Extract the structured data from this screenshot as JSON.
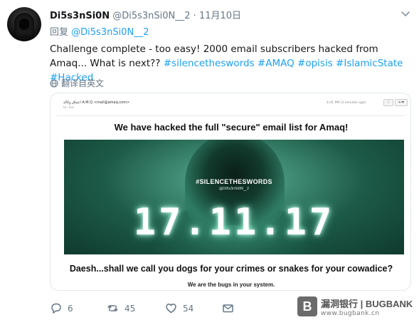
{
  "tweet": {
    "author_name": "Di5s3nSi0N",
    "author_handle": "@Di5s3nSi0N__2",
    "separator": "·",
    "date": "11月10日",
    "reply_prefix": "回复",
    "reply_to": "@Di5s3nSi0N__2",
    "text_main": "Challenge complete - too easy! 2000 email subscribers hacked from Amaq... What is next?? ",
    "hashtags": [
      "#silencetheswords",
      "#AMAQ",
      "#opisis",
      "#IslamicState",
      "#Hacked"
    ],
    "translate_label": "翻译自英文"
  },
  "media": {
    "mail_from": "اعماق وكالة A.M.Q <mail@amaq.com>",
    "mail_to": "to: me",
    "mail_time": "4:41 PM (3 minutes ago)",
    "headline": "We have hacked the full \"secure\" email list for Amaq!",
    "poster_hashtag": "#SILENCETHESWORDS",
    "poster_sub": "@Di5s3nSi0N__2",
    "poster_date": "17.11.17",
    "question": "Daesh...shall we call you dogs for your crimes or snakes for your cowadice?",
    "bugs_line": "We are the bugs in your system."
  },
  "actions": {
    "reply_count": "6",
    "retweet_count": "45",
    "like_count": "54"
  },
  "watermark": {
    "logo_letter": "B",
    "top": "漏洞银行 | BUGBANK",
    "bottom": "www.bugbank.cn"
  },
  "colors": {
    "link": "#1da1f2",
    "muted": "#657786",
    "poster_green": "#2e7a62"
  }
}
